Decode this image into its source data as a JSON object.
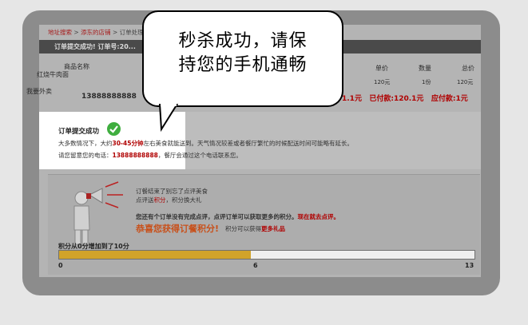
{
  "breadcrumb": {
    "link1": "地址搜索",
    "sep": " > ",
    "link2": "添东的店铺",
    "current": "订单处理完..."
  },
  "darkbar": {
    "text": "订单提交成功!   订单号:20..."
  },
  "table": {
    "col_name": "商品名称",
    "col_price": "单价",
    "col_qty": "数量",
    "col_total": "总价",
    "item_name": "红烧牛肉面",
    "price": "120元",
    "qty": "1份",
    "total": "120元"
  },
  "side_label": "我要外卖",
  "phone": "13888888888",
  "summary": {
    "amount_tail": "1.1元",
    "paid_label": "已付款:",
    "paid_value": "120.1元",
    "due_label": "应付款:",
    "due_value": "1元"
  },
  "bubble": {
    "line1": "秒杀成功，请保",
    "line2": "持您的手机通畅"
  },
  "success": {
    "title": "订单提交成功",
    "line1_a": "大多数情况下，大约",
    "line1_time": "30-45分钟",
    "line1_b": "左右美食就能送到。天气情况较差或者餐厅繁忙的时候配送时间可能略有延长。",
    "line2_a": "请您留意您的电话：",
    "line2_phone": "13888888888",
    "line2_b": "，餐厅会通过这个电话联系您。"
  },
  "rating": {
    "l1": "订餐结束了别忘了点评美食",
    "l2_a": "点评送",
    "l2_b": "积分",
    "l2_c": "，积分换大礼",
    "l3_a": "您还有个订单没有完成点评，点评订单可以获取更多的积分。",
    "l3_link": "现在就去点评。",
    "big": "恭喜您获得订餐积分!",
    "l4_a": "积分可以获得",
    "l4_link": "更多礼品"
  },
  "progress": {
    "label": "积分从0分增加到了10分",
    "value": 10,
    "max": 13,
    "ticks": [
      "0",
      "6",
      "13"
    ]
  },
  "colors": {
    "accent_red": "#b00000",
    "progress_fill": "#d1a32a",
    "success_green": "#3fae3f"
  }
}
